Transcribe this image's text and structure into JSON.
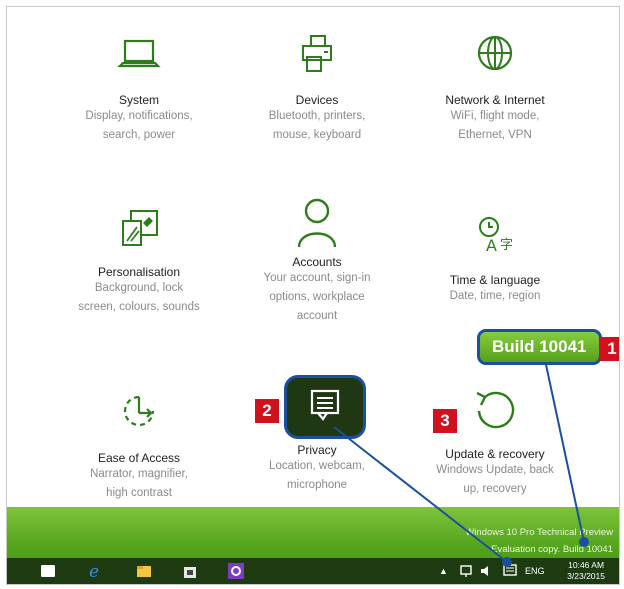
{
  "tiles": [
    {
      "title": "System",
      "desc": [
        "Display, notifications,",
        "search, power"
      ],
      "icon": "laptop-icon"
    },
    {
      "title": "Devices",
      "desc": [
        "Bluetooth, printers,",
        "mouse, keyboard"
      ],
      "icon": "printer-icon"
    },
    {
      "title": "Network & Internet",
      "desc": [
        "WiFi, flight mode,",
        "Ethernet, VPN"
      ],
      "icon": "globe-icon"
    },
    {
      "title": "Personalisation",
      "desc": [
        "Background, lock",
        "screen, colours, sounds"
      ],
      "icon": "paintbrush-icon"
    },
    {
      "title": "Accounts",
      "desc": [
        "Your account, sign-in",
        "options, workplace",
        "account"
      ],
      "icon": "person-icon"
    },
    {
      "title": "Time & language",
      "desc": [
        "Date, time, region"
      ],
      "icon": "clock-language-icon"
    },
    {
      "title": "Ease of Access",
      "desc": [
        "Narrator, magnifier,",
        "high contrast"
      ],
      "icon": "accessibility-icon"
    },
    {
      "title": "Privacy",
      "desc": [
        "Location, webcam,",
        "microphone"
      ],
      "icon": "message-icon"
    },
    {
      "title": "Update & recovery",
      "desc": [
        "Windows Update, back",
        "up, recovery"
      ],
      "icon": "refresh-icon"
    }
  ],
  "annotations": {
    "build_label": "Build 10041",
    "badge1": "1",
    "badge2": "2",
    "badge3": "3"
  },
  "watermark": {
    "line1": "Windows 10 Pro Technical Preview",
    "line2": "Evaluation copy. Build 10041"
  },
  "taskbar": {
    "language": "ENG",
    "time": "10:46 AM",
    "date": "3/23/2015",
    "apps": [
      "start-button",
      "edge-icon",
      "file-explorer-icon",
      "store-icon",
      "app-icon"
    ]
  },
  "colors": {
    "accent": "#2e7d1d",
    "badge": "#d1111c",
    "callout_border": "#1c4f9e"
  }
}
